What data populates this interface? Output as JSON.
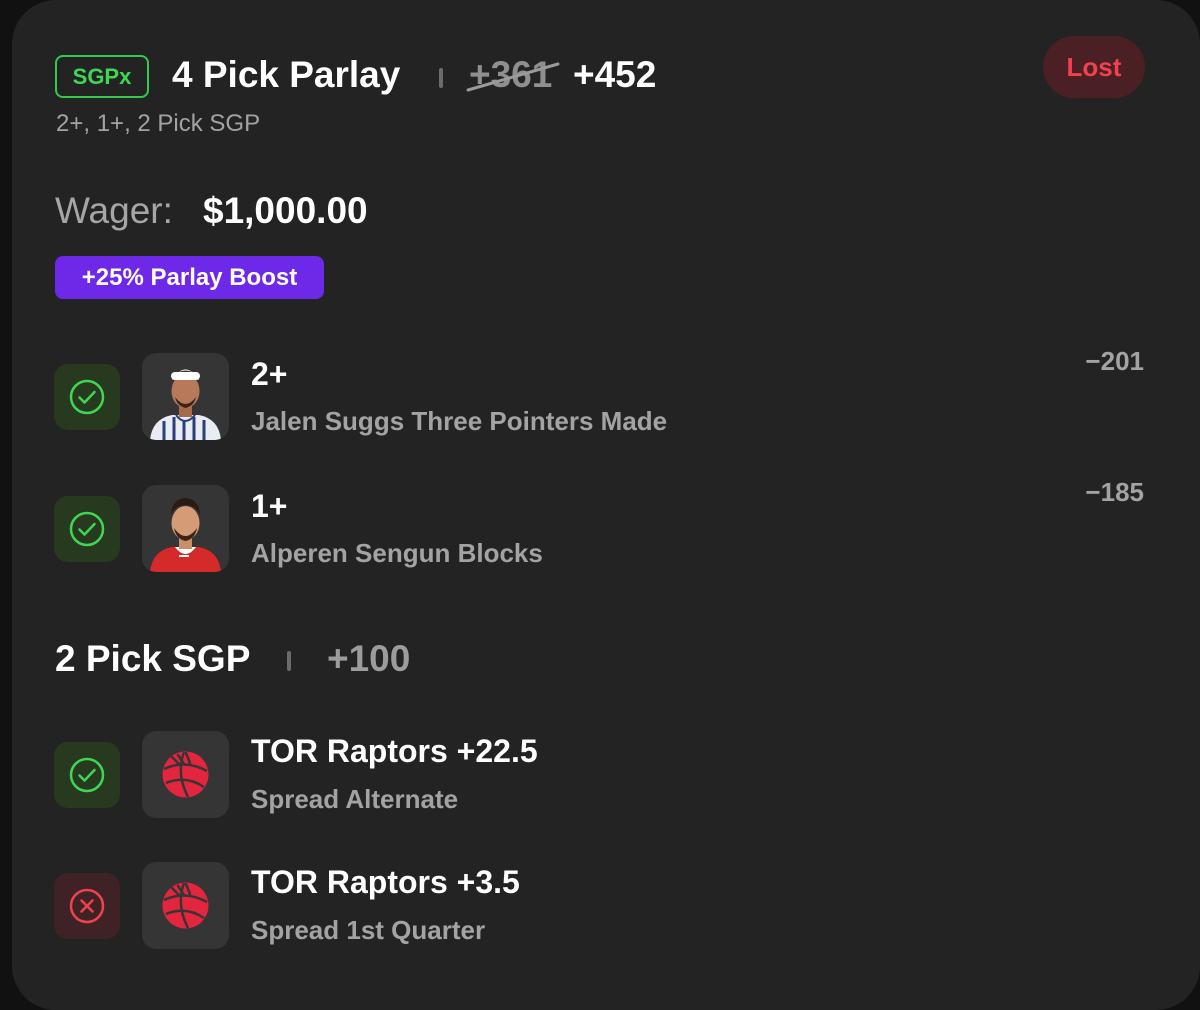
{
  "header": {
    "badge": "SGPx",
    "title": "4 Pick Parlay",
    "original_odds": "+361",
    "boosted_odds": "+452",
    "subtitle": "2+, 1+, 2 Pick SGP",
    "status": "Lost"
  },
  "wager": {
    "label": "Wager:",
    "amount": "$1,000.00"
  },
  "boost": {
    "label": "+25% Parlay Boost"
  },
  "legs": [
    {
      "line": "2+",
      "description": "Jalen Suggs Three Pointers Made",
      "odds": "−201",
      "result": "won",
      "image": "player-headshot"
    },
    {
      "line": "1+",
      "description": "Alperen Sengun Blocks",
      "odds": "−185",
      "result": "won",
      "image": "player-headshot"
    }
  ],
  "sgp_group": {
    "title": "2 Pick SGP",
    "odds": "+100",
    "legs": [
      {
        "line": "TOR Raptors +22.5",
        "description": "Spread Alternate",
        "result": "won",
        "image": "raptors-logo"
      },
      {
        "line": "TOR Raptors +3.5",
        "description": "Spread 1st Quarter",
        "result": "lost",
        "image": "raptors-logo"
      }
    ]
  },
  "colors": {
    "card_bg": "#232323",
    "win_green": "#3fd653",
    "loss_red": "#f0414c",
    "boost_purple": "#6d28e8"
  }
}
